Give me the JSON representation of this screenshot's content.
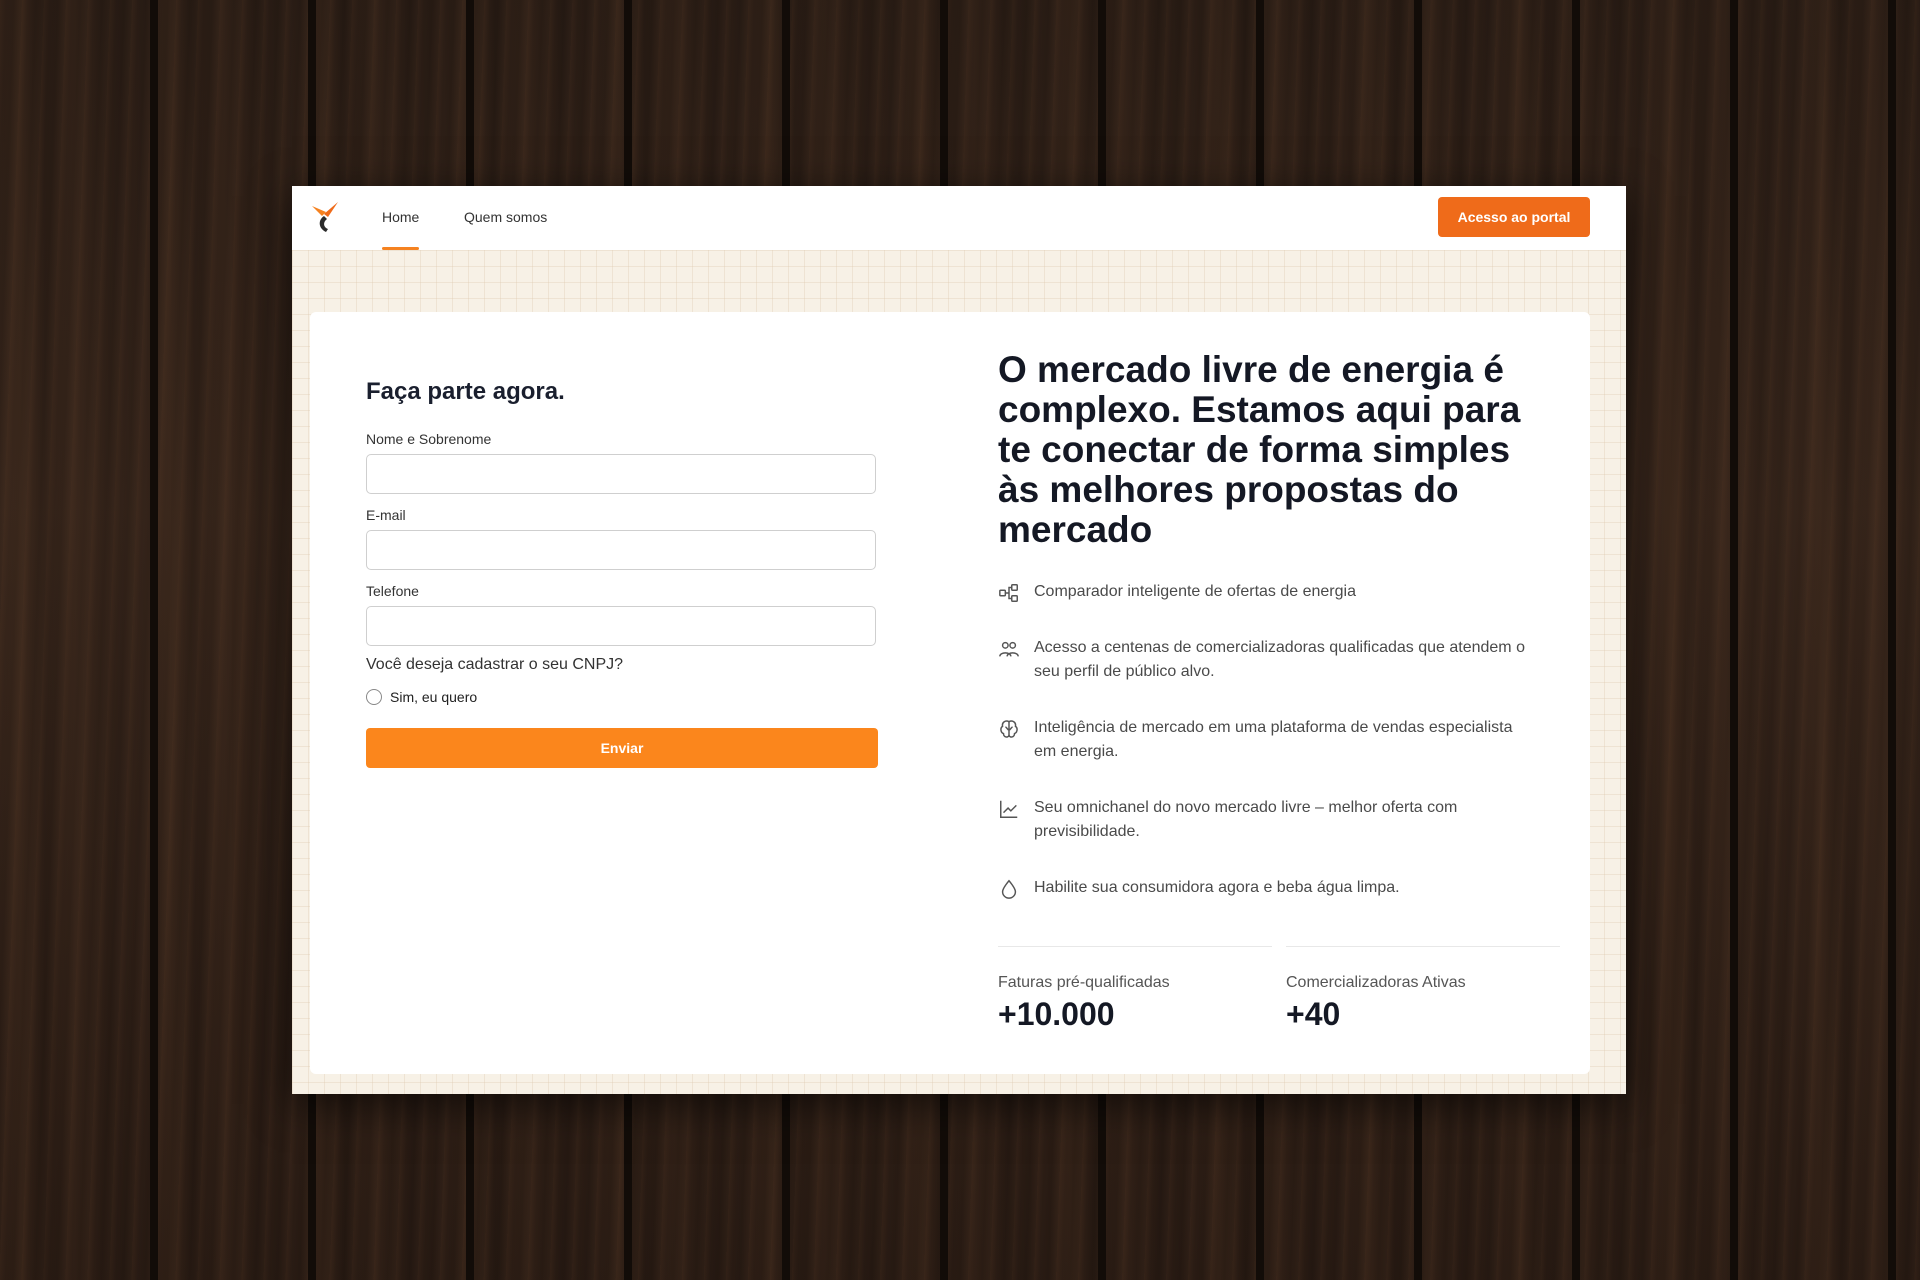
{
  "colors": {
    "accent": "#f58220",
    "portal_button": "#ef6b1a",
    "submit_button": "#fb861c",
    "text_dark": "#141824"
  },
  "nav": {
    "links": [
      {
        "label": "Home",
        "active": true
      },
      {
        "label": "Quem somos",
        "active": false
      }
    ],
    "portal_button": "Acesso ao portal"
  },
  "form": {
    "title": "Faça parte agora.",
    "fields": [
      {
        "label": "Nome e Sobrenome",
        "value": ""
      },
      {
        "label": "E-mail",
        "value": ""
      },
      {
        "label": "Telefone",
        "value": ""
      }
    ],
    "question": "Você deseja cadastrar o seu CNPJ?",
    "option": "Sim, eu quero",
    "submit": "Enviar"
  },
  "hero": {
    "headline": "O mercado livre de energia é complexo. Estamos aqui para te conectar de forma simples às melhores propostas do mercado",
    "features": [
      {
        "icon": "compare-icon",
        "text": "Comparador inteligente de ofertas de energia"
      },
      {
        "icon": "users-icon",
        "text": "Acesso a centenas de comercializadoras qualificadas que atendem o seu perfil de público alvo."
      },
      {
        "icon": "brain-icon",
        "text": "Inteligência de mercado em uma plataforma de vendas especialista em energia."
      },
      {
        "icon": "trend-chart-icon",
        "text": "Seu omnichanel do novo mercado livre – melhor oferta com previsibilidade."
      },
      {
        "icon": "water-drop-icon",
        "text": "Habilite sua consumidora agora e beba água limpa."
      }
    ],
    "stats": [
      {
        "label": "Faturas pré-qualificadas",
        "value": "+10.000"
      },
      {
        "label": "Comercializadoras Ativas",
        "value": "+40"
      }
    ]
  }
}
